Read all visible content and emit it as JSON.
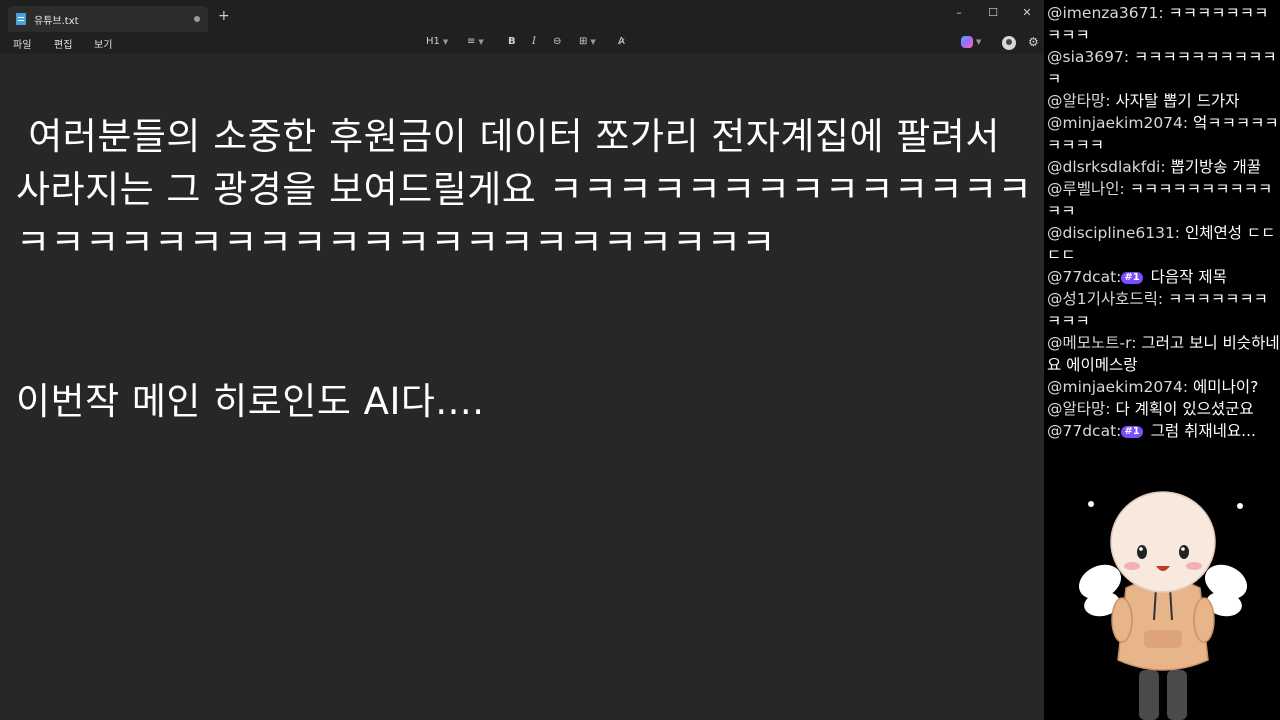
{
  "window": {
    "tab_title": "유튜브.txt",
    "new_tab": "+",
    "minimize": "–",
    "maximize": "☐",
    "close": "✕"
  },
  "menu": {
    "file": "파일",
    "edit": "편집",
    "view": "보기"
  },
  "toolbar": {
    "heading": "H1",
    "list": "≡",
    "bold": "B",
    "italic": "I",
    "link": "⊖",
    "table": "⊞",
    "clear_format": "A̷",
    "copilot_icon": "copilot-icon",
    "profile_icon": "profile-icon",
    "settings": "⚙"
  },
  "editor": {
    "text": " 여러분들의 소중한 후원금이 데이터 쪼가리 전자계집에 팔려서 사라지는 그 광경을 보여드릴게요 ㅋㅋㅋㅋㅋㅋㅋㅋㅋㅋㅋㅋㅋㅋㅋㅋㅋㅋㅋㅋㅋㅋㅋㅋㅋㅋㅋㅋㅋㅋㅋㅋㅋㅋㅋㅋ\n\n\n이번작 메인 히로인도 AI다...."
  },
  "chat": [
    {
      "user": "@imenza3671:",
      "text": " ㅋㅋㅋㅋㅋㅋㅋㅋㅋㅋ"
    },
    {
      "user": "@sia3697:",
      "text": " ㅋㅋㅋㅋㅋㅋㅋㅋㅋㅋㅋ"
    },
    {
      "user": "@알타망:",
      "text": " 사자탈 뽑기 드가자"
    },
    {
      "user": "@minjaekim2074:",
      "text": " 엌ㅋㅋㅋㅋㅋㅋㅋㅋㅋ"
    },
    {
      "user": "@dlsrksdlakfdi:",
      "text": " 뽑기방송 개꿀"
    },
    {
      "user": "@루벨나인:",
      "text": " ㅋㅋㅋㅋㅋㅋㅋㅋㅋㅋㅋㅋ"
    },
    {
      "user": "@discipline6131:",
      "text": " 인체연성 ㄷㄷㄷㄷ"
    },
    {
      "user": "@77dcat:",
      "badge": "#1",
      "text": " 다음작 제목"
    },
    {
      "user": "@성1기사호드릭:",
      "text": " ㅋㅋㅋㅋㅋㅋㅋㅋㅋㅋ"
    },
    {
      "user": "@메모노트-r:",
      "text": " 그러고 보니 비슷하네요 에이메스랑"
    },
    {
      "user": "@minjaekim2074:",
      "text": " 에미나이?"
    },
    {
      "user": "@알타망:",
      "text": " 다 계획이 있으셨군요"
    },
    {
      "user": "@77dcat:",
      "badge": "#1",
      "text": " 그럼 취재네요..."
    }
  ],
  "colors": {
    "window_bg": "#272727",
    "titlebar_bg": "#202020",
    "badge": "#7c4dff",
    "hoodie": "#e8b48a"
  }
}
